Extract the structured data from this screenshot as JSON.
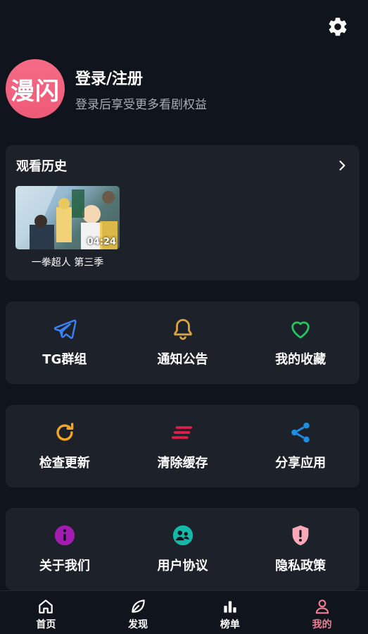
{
  "profile": {
    "avatar_text": "漫闪",
    "login_title": "登录/注册",
    "login_subtitle": "登录后享受更多看剧权益"
  },
  "history": {
    "title": "观看历史",
    "items": [
      {
        "title": "一拳超人 第三季",
        "duration": "04:24"
      }
    ]
  },
  "menu_rows": [
    [
      {
        "label": "TG群组",
        "icon": "telegram-icon",
        "color": "#3b82f6"
      },
      {
        "label": "通知公告",
        "icon": "bell-icon",
        "color": "#d9a441"
      },
      {
        "label": "我的收藏",
        "icon": "heart-icon",
        "color": "#22c55e"
      }
    ],
    [
      {
        "label": "检查更新",
        "icon": "refresh-icon",
        "color": "#f5a524"
      },
      {
        "label": "清除缓存",
        "icon": "clear-cache-icon",
        "color": "#e11d48"
      },
      {
        "label": "分享应用",
        "icon": "share-icon",
        "color": "#1d8fe0"
      }
    ],
    [
      {
        "label": "关于我们",
        "icon": "info-icon",
        "color": "#a21caf"
      },
      {
        "label": "用户协议",
        "icon": "user-agreement-icon",
        "color": "#14b8a6"
      },
      {
        "label": "隐私政策",
        "icon": "privacy-shield-icon",
        "color": "#f9a8b8"
      }
    ]
  ],
  "tabs": [
    {
      "label": "首页",
      "icon": "home-icon",
      "active": false
    },
    {
      "label": "发现",
      "icon": "leaf-icon",
      "active": false
    },
    {
      "label": "榜单",
      "icon": "chart-icon",
      "active": false
    },
    {
      "label": "我的",
      "icon": "user-icon",
      "active": true
    }
  ],
  "colors": {
    "background": "#10141c",
    "card": "#1d2129",
    "accent": "#f27a92",
    "avatar": "#f56c86"
  }
}
